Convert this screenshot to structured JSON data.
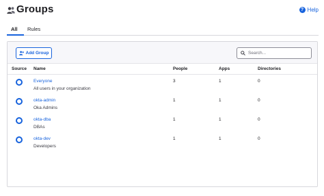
{
  "header": {
    "title": "Groups",
    "help_label": "Help"
  },
  "tabs": [
    {
      "label": "All",
      "active": true
    },
    {
      "label": "Rules",
      "active": false
    }
  ],
  "toolbar": {
    "add_label": "Add Group",
    "search_placeholder": "Search..."
  },
  "table": {
    "columns": [
      "Source",
      "Name",
      "People",
      "Apps",
      "Directories"
    ],
    "rows": [
      {
        "source_icon": "okta-icon",
        "name": "Everyone",
        "description": "All users in your organization",
        "people": "3",
        "apps": "1",
        "directories": "0"
      },
      {
        "source_icon": "okta-icon",
        "name": "okta-admin",
        "description": "Oka Admins",
        "people": "1",
        "apps": "1",
        "directories": "0"
      },
      {
        "source_icon": "okta-icon",
        "name": "okta-dba",
        "description": "DBAs",
        "people": "1",
        "apps": "1",
        "directories": "0"
      },
      {
        "source_icon": "okta-icon",
        "name": "okta-dev",
        "description": "Developers",
        "people": "1",
        "apps": "1",
        "directories": "0"
      }
    ]
  },
  "colors": {
    "accent": "#1662dd",
    "text": "#1d1d21",
    "border": "#d7d7dc"
  }
}
